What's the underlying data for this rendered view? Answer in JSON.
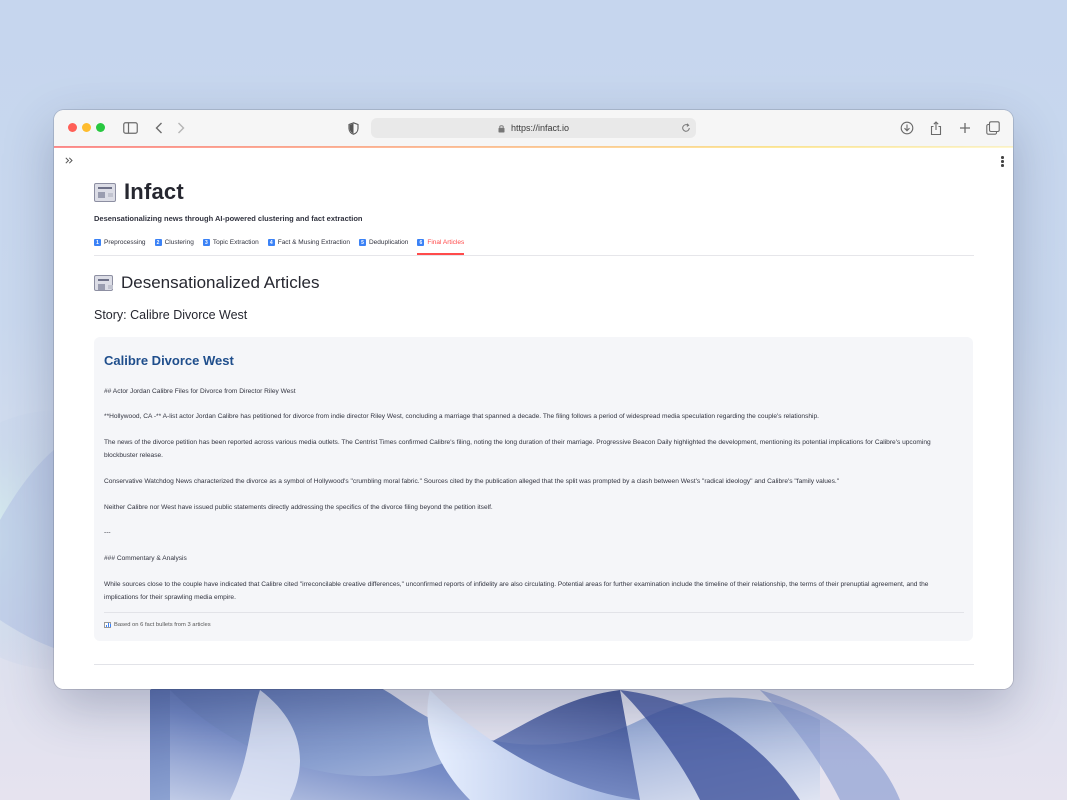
{
  "browser": {
    "url": "https://infact.io"
  },
  "app": {
    "title": "Infact",
    "subtitle": "Desensationalizing news through AI-powered clustering and fact extraction"
  },
  "tabs": [
    {
      "num": "1",
      "label": "Preprocessing",
      "active": false
    },
    {
      "num": "2",
      "label": "Clustering",
      "active": false
    },
    {
      "num": "3",
      "label": "Topic Extraction",
      "active": false
    },
    {
      "num": "4",
      "label": "Fact & Musing Extraction",
      "active": false
    },
    {
      "num": "5",
      "label": "Deduplication",
      "active": false
    },
    {
      "num": "6",
      "label": "Final Articles",
      "active": true
    }
  ],
  "section": {
    "title": "Desensationalized Articles",
    "story": "Story: Calibre Divorce West"
  },
  "article": {
    "title": "Calibre Divorce West",
    "paragraphs": [
      "## Actor Jordan Calibre Files for Divorce from Director Riley West",
      "**Hollywood, CA -** A-list actor Jordan Calibre has petitioned for divorce from indie director Riley West, concluding a marriage that spanned a decade. The filing follows a period of widespread media speculation regarding the couple's relationship.",
      "The news of the divorce petition has been reported across various media outlets. The Centrist Times confirmed Calibre's filing, noting the long duration of their marriage. Progressive Beacon Daily highlighted the development, mentioning its potential implications for Calibre's upcoming blockbuster release.",
      "Conservative Watchdog News characterized the divorce as a symbol of Hollywood's \"crumbling moral fabric.\" Sources cited by the publication alleged that the split was prompted by a clash between West's \"radical ideology\" and Calibre's \"family values.\"",
      "Neither Calibre nor West have issued public statements directly addressing the specifics of the divorce filing beyond the petition itself.",
      "---",
      "### Commentary & Analysis",
      "While sources close to the couple have indicated that Calibre cited \"irreconcilable creative differences,\" unconfirmed reports of infidelity are also circulating. Potential areas for further examination include the timeline of their relationship, the terms of their prenuptial agreement, and the implications for their sprawling media empire."
    ],
    "footer": "Based on 6 fact bullets from 3 articles"
  },
  "colors": {
    "accent": "#ff4b4b",
    "tab_number": "#3b82f6",
    "article_title": "#1f4e8c"
  }
}
